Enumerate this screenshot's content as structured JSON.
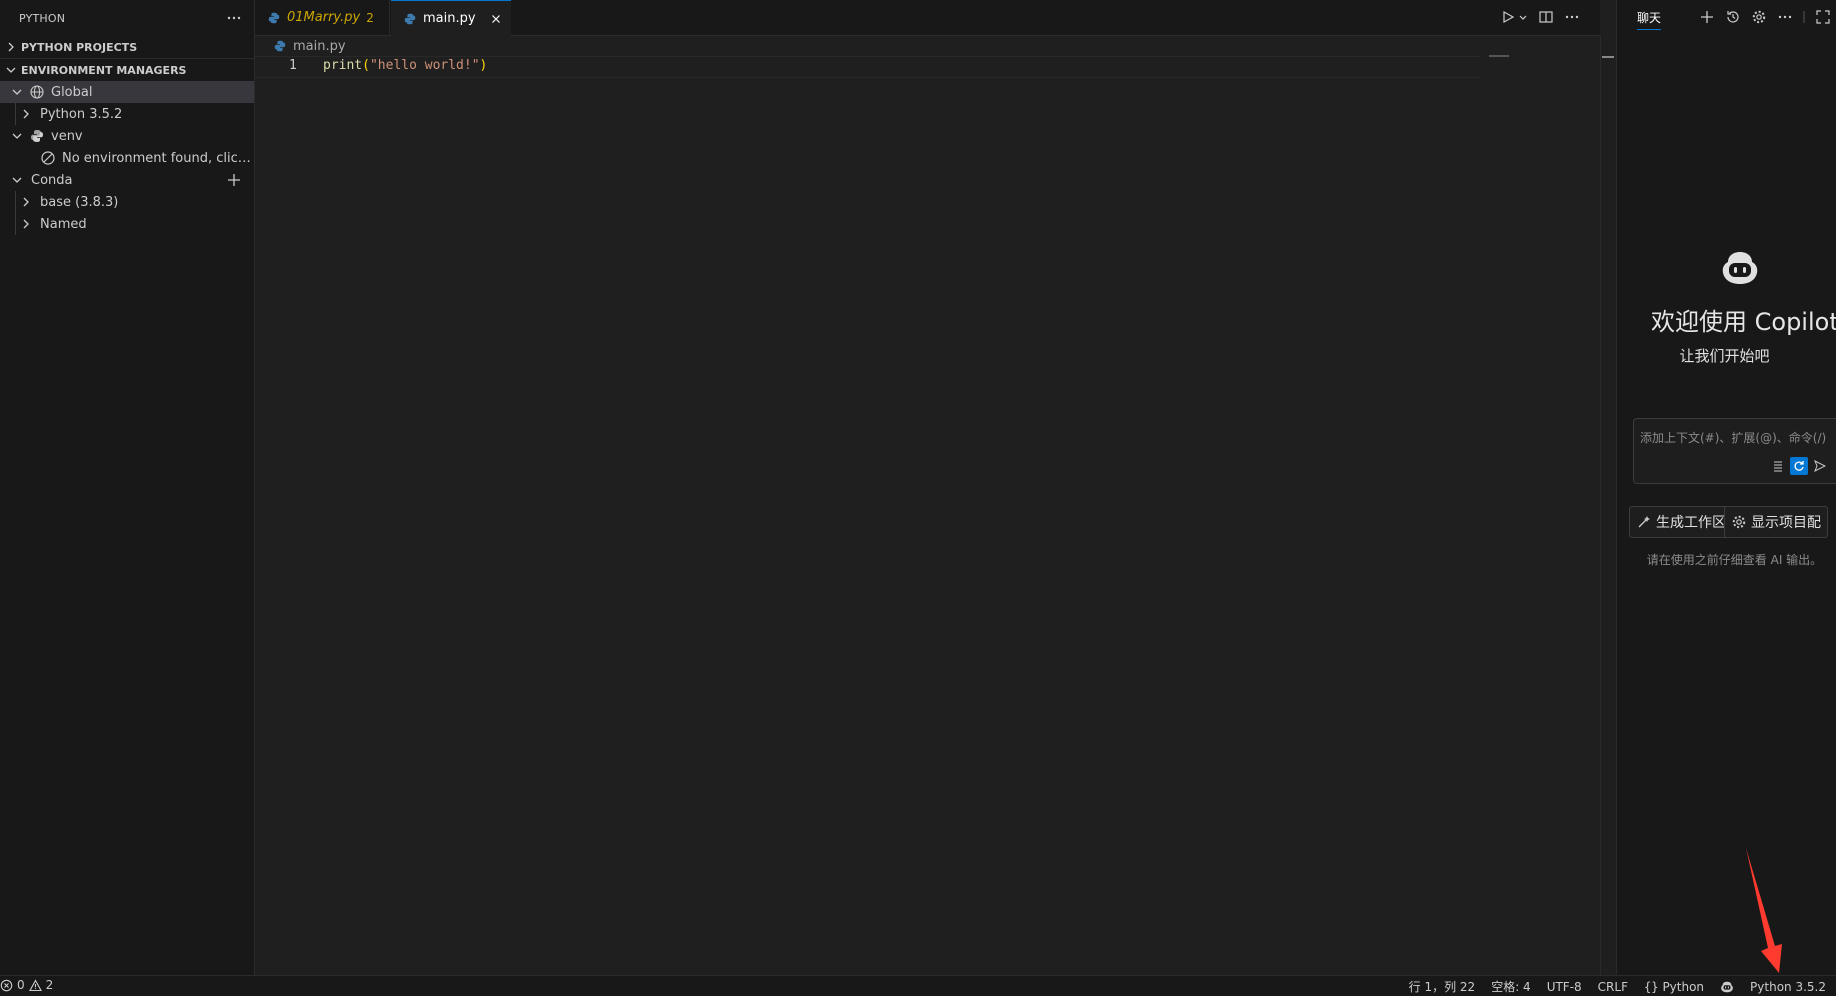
{
  "sidebar": {
    "title": "PYTHON",
    "sections": {
      "projects": "PYTHON PROJECTS",
      "env_managers": "ENVIRONMENT MANAGERS"
    },
    "tree": {
      "global": "Global",
      "python352": "Python 3.5.2",
      "venv": "venv",
      "no_env": "No environment found, click t...",
      "conda": "Conda",
      "base": "base (3.8.3)",
      "named": "Named"
    }
  },
  "tabs": [
    {
      "label": "01Marry.py",
      "badge": "2"
    },
    {
      "label": "main.py"
    }
  ],
  "breadcrumb": "main.py",
  "editor": {
    "line_number": "1",
    "code": {
      "fn": "print",
      "open": "(",
      "str": "\"hello world!\"",
      "close": ")"
    }
  },
  "chat": {
    "tab_title": "聊天",
    "welcome": "欢迎使用 Copilot",
    "subtitle": "让我们开始吧",
    "input_placeholder": "添加上下文(#)、扩展(@)、命令(/)",
    "chip_generate": "生成工作区",
    "chip_config": "显示项目配",
    "disclaimer": "请在使用之前仔细查看 AI 输出。"
  },
  "status": {
    "errors": "0",
    "warnings": "2",
    "position": "行 1，列 22",
    "spaces": "空格: 4",
    "encoding": "UTF-8",
    "eol": "CRLF",
    "language": "Python",
    "interpreter": "Python 3.5.2"
  },
  "colors": {
    "accent": "#0078d4",
    "warning": "#cca700",
    "arrow": "#ff3b30"
  }
}
